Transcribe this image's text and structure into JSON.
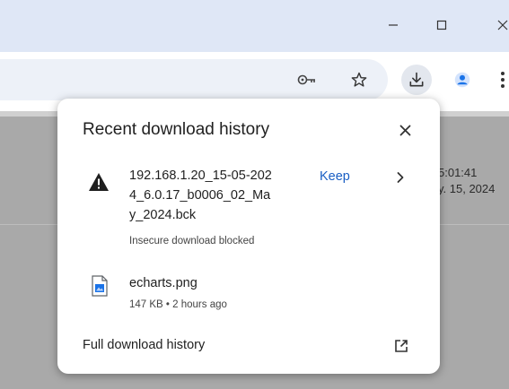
{
  "window": {
    "controls": [
      "minimize-icon",
      "maximize-icon",
      "close-icon"
    ]
  },
  "toolbar": {
    "icons": [
      "key-icon",
      "star-icon",
      "download-icon",
      "profile-icon",
      "more-vert-icon"
    ]
  },
  "page": {
    "time_text": "5:01:41",
    "date_text": "y. 15, 2024"
  },
  "downloads_popup": {
    "title": "Recent download history",
    "items": [
      {
        "icon": "warning-icon",
        "name_lines": [
          "192.168.1.20_15-05-202",
          "4_6.0.17_b0006_02_Ma",
          "y_2024.bck"
        ],
        "status": "Insecure download blocked",
        "action_label": "Keep"
      },
      {
        "icon": "image-file-icon",
        "name": "echarts.png",
        "meta": "147 KB • 2 hours ago"
      }
    ],
    "footer_label": "Full download history"
  },
  "colors": {
    "titlebar": "#dfe7f6",
    "link": "#1a5fc4",
    "profile": "#1a73e8"
  }
}
